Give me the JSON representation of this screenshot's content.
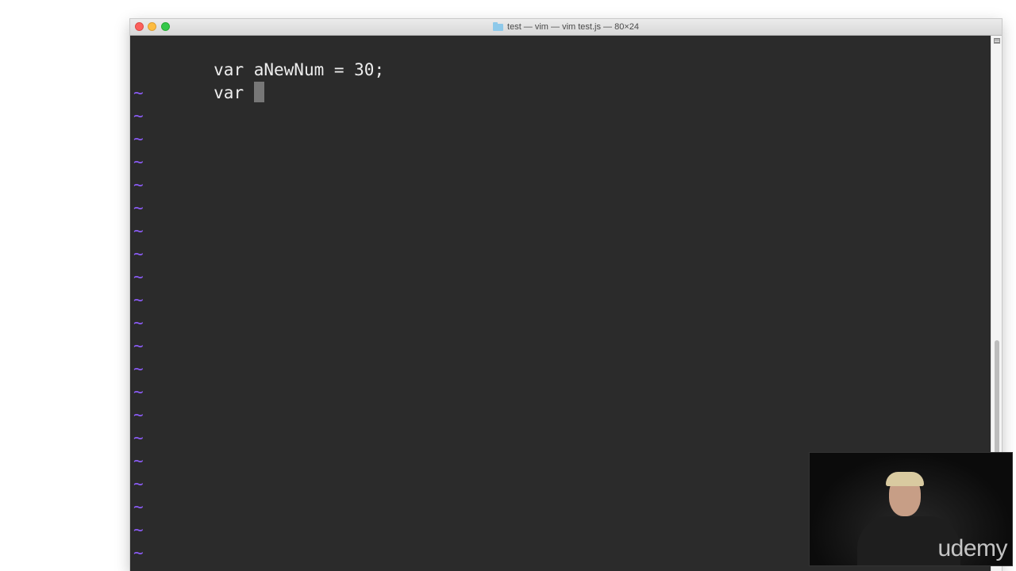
{
  "window": {
    "title": "test — vim — vim test.js — 80×24",
    "folder_icon": "folder-icon"
  },
  "editor": {
    "lines": [
      "var aNewNum = 30;",
      "var "
    ],
    "empty_line_marker": "~",
    "tilde_color": "#8b5cf6",
    "text_color": "#eeeeee",
    "background": "#2b2b2b"
  },
  "overlay": {
    "watermark": "udemy"
  }
}
